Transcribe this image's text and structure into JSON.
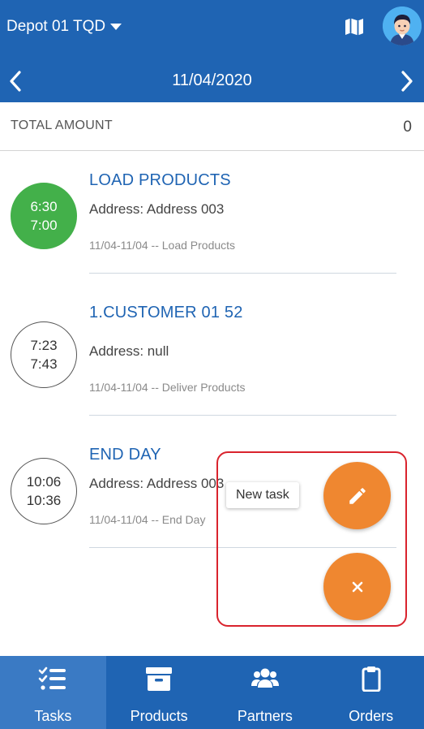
{
  "header": {
    "depot_label": "Depot 01 TQD",
    "date": "11/04/2020",
    "icons": {
      "map": "map-icon",
      "avatar": "user-avatar",
      "prev": "chevron-left-icon",
      "next": "chevron-right-icon",
      "depot_dropdown": "caret-down-icon"
    }
  },
  "summary": {
    "label": "TOTAL AMOUNT",
    "value": "0"
  },
  "tasks": [
    {
      "start": "6:30",
      "end": "7:00",
      "title": "LOAD PRODUCTS",
      "address": "Address: Address 003",
      "meta": "11/04-11/04 -- Load Products",
      "status": "completed"
    },
    {
      "start": "7:23",
      "end": "7:43",
      "title": "1.CUSTOMER 01 52",
      "address": "Address: null",
      "meta": "11/04-11/04 -- Deliver Products",
      "status": "pending"
    },
    {
      "start": "10:06",
      "end": "10:36",
      "title": "END DAY",
      "address": "Address: Address 003",
      "meta": "11/04-11/04 -- End Day",
      "status": "pending"
    }
  ],
  "fab": {
    "tooltip": "New task",
    "edit_icon": "pencil-icon",
    "close_icon": "close-icon"
  },
  "bottom_nav": [
    {
      "label": "Tasks",
      "icon": "tasks-checklist-icon",
      "active": true
    },
    {
      "label": "Products",
      "icon": "archive-box-icon",
      "active": false
    },
    {
      "label": "Partners",
      "icon": "users-group-icon",
      "active": false
    },
    {
      "label": "Orders",
      "icon": "clipboard-icon",
      "active": false
    }
  ],
  "colors": {
    "primary": "#1f64b3",
    "accent": "#ef8730",
    "completed": "#43b04a",
    "highlight": "#d9232d"
  }
}
